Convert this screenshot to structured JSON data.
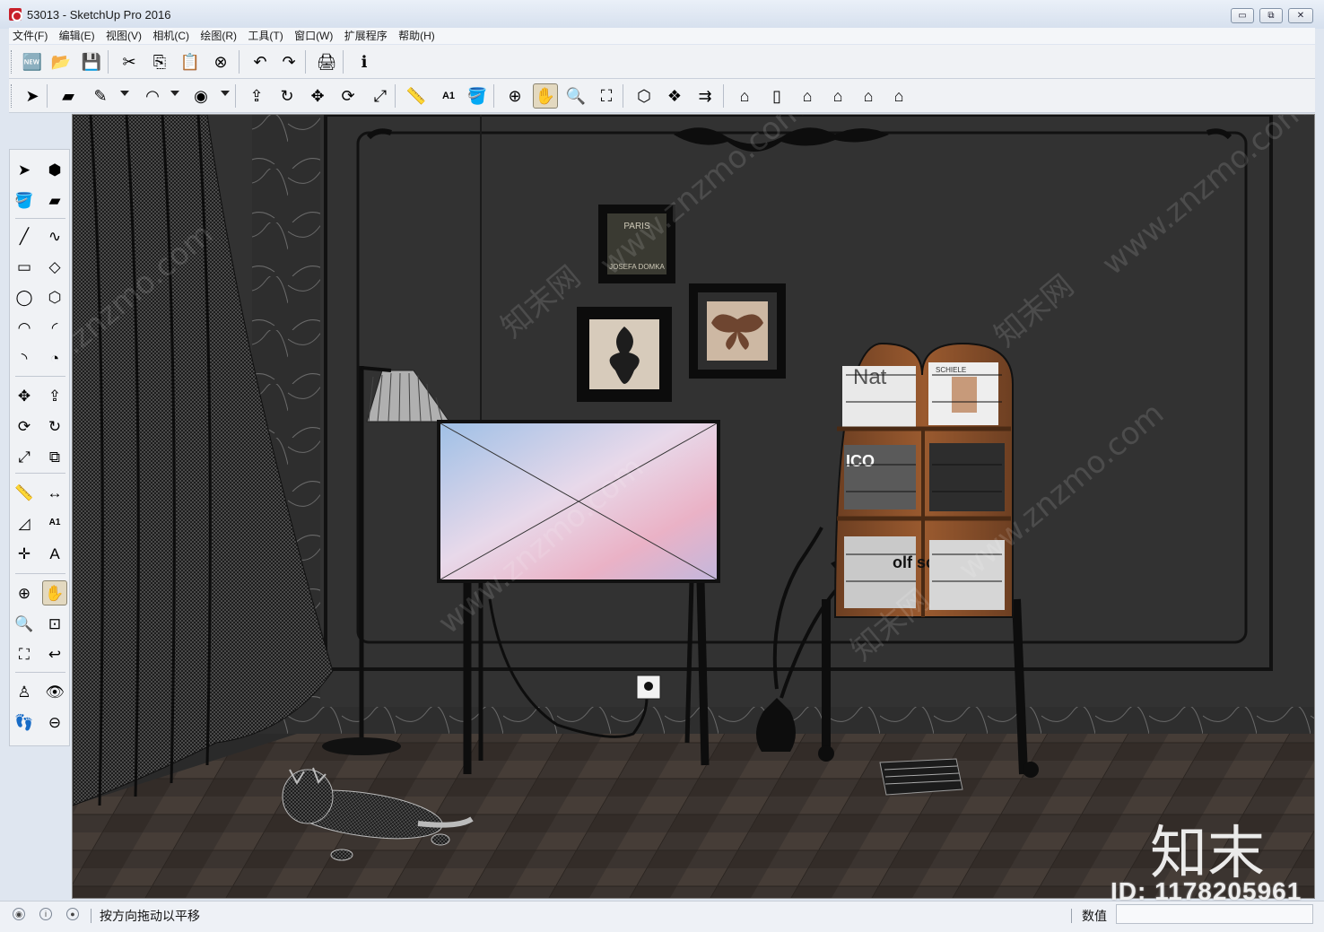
{
  "window": {
    "title": "53013 - SketchUp Pro 2016",
    "minimize_glyph": "▭",
    "restore_glyph": "⧉",
    "close_glyph": "✕"
  },
  "menu": [
    "文件(F)",
    "编辑(E)",
    "视图(V)",
    "相机(C)",
    "绘图(R)",
    "工具(T)",
    "窗口(W)",
    "扩展程序",
    "帮助(H)"
  ],
  "toolbar_standard": [
    {
      "icon": "new-model-icon",
      "glyph": "🆕"
    },
    {
      "icon": "open-folder-icon",
      "glyph": "📂"
    },
    {
      "icon": "save-icon",
      "glyph": "💾"
    },
    {
      "icon": "cut-icon",
      "glyph": "✂"
    },
    {
      "icon": "copy-icon",
      "glyph": "⎘"
    },
    {
      "icon": "paste-icon",
      "glyph": "📋"
    },
    {
      "icon": "delete-icon",
      "glyph": "⊗"
    },
    {
      "icon": "undo-icon",
      "glyph": "↶"
    },
    {
      "icon": "redo-icon",
      "glyph": "↷"
    },
    {
      "icon": "print-icon",
      "glyph": "🖨"
    },
    {
      "icon": "model-info-icon",
      "glyph": "ℹ"
    }
  ],
  "toolbar_large": [
    {
      "icon": "select-arrow-icon",
      "glyph": "➤"
    },
    {
      "icon": "eraser-icon",
      "glyph": "▰"
    },
    {
      "icon": "pencil-line-icon",
      "glyph": "✎"
    },
    {
      "icon": "arc-icon",
      "glyph": "◠"
    },
    {
      "icon": "circle-icon",
      "glyph": "◉"
    },
    {
      "icon": "push-pull-icon",
      "glyph": "⇪"
    },
    {
      "icon": "follow-me-icon",
      "glyph": "↻"
    },
    {
      "icon": "move-icon",
      "glyph": "✥"
    },
    {
      "icon": "rotate-icon",
      "glyph": "⟳"
    },
    {
      "icon": "scale-icon",
      "glyph": "⤢"
    },
    {
      "icon": "tape-measure-icon",
      "glyph": "📏"
    },
    {
      "icon": "text-icon",
      "glyph": "A1"
    },
    {
      "icon": "paint-bucket-icon",
      "glyph": "🪣"
    },
    {
      "icon": "orbit-icon",
      "glyph": "⊕"
    },
    {
      "icon": "pan-hand-icon",
      "glyph": "✋"
    },
    {
      "icon": "zoom-icon",
      "glyph": "🔍"
    },
    {
      "icon": "zoom-extents-icon",
      "glyph": "⛶"
    },
    {
      "icon": "warehouse-icon",
      "glyph": "⬡"
    },
    {
      "icon": "components-icon",
      "glyph": "❖"
    },
    {
      "icon": "share-model-icon",
      "glyph": "⇉"
    },
    {
      "icon": "iso-view-icon",
      "glyph": "⌂"
    },
    {
      "icon": "front-view-icon",
      "glyph": "▯"
    },
    {
      "icon": "house-top-view-icon",
      "glyph": "⌂"
    },
    {
      "icon": "right-view-icon",
      "glyph": "⌂"
    },
    {
      "icon": "back-view-icon",
      "glyph": "⌂"
    },
    {
      "icon": "left-view-icon",
      "glyph": "⌂"
    }
  ],
  "left_tools": [
    {
      "icon": "select-icon",
      "glyph": "➤"
    },
    {
      "icon": "make-component-icon",
      "glyph": "⬢"
    },
    {
      "icon": "paint-bucket-icon",
      "glyph": "🪣"
    },
    {
      "icon": "eraser-icon",
      "glyph": "▰"
    },
    {
      "icon": "line-icon",
      "glyph": "╱"
    },
    {
      "icon": "freehand-icon",
      "glyph": "∿"
    },
    {
      "icon": "rectangle-icon",
      "glyph": "▭"
    },
    {
      "icon": "rotated-rectangle-icon",
      "glyph": "◇"
    },
    {
      "icon": "circle-icon",
      "glyph": "◯"
    },
    {
      "icon": "polygon-icon",
      "glyph": "⬡"
    },
    {
      "icon": "arc-icon",
      "glyph": "◠"
    },
    {
      "icon": "two-point-arc-icon",
      "glyph": "◜"
    },
    {
      "icon": "three-point-arc-icon",
      "glyph": "◝"
    },
    {
      "icon": "pie-icon",
      "glyph": "◔"
    },
    {
      "icon": "move-icon",
      "glyph": "✥"
    },
    {
      "icon": "push-pull-icon",
      "glyph": "⇪"
    },
    {
      "icon": "rotate-icon",
      "glyph": "⟳"
    },
    {
      "icon": "follow-me-icon",
      "glyph": "↻"
    },
    {
      "icon": "scale-icon",
      "glyph": "⤢"
    },
    {
      "icon": "offset-icon",
      "glyph": "⧉"
    },
    {
      "icon": "tape-measure-icon",
      "glyph": "📏"
    },
    {
      "icon": "dimension-icon",
      "glyph": "↔"
    },
    {
      "icon": "protractor-icon",
      "glyph": "◿"
    },
    {
      "icon": "text-icon",
      "glyph": "A1"
    },
    {
      "icon": "axes-icon",
      "glyph": "✛"
    },
    {
      "icon": "3d-text-icon",
      "glyph": "A"
    },
    {
      "icon": "orbit-icon",
      "glyph": "⊕"
    },
    {
      "icon": "pan-hand-icon",
      "glyph": "✋"
    },
    {
      "icon": "zoom-icon",
      "glyph": "🔍"
    },
    {
      "icon": "zoom-window-icon",
      "glyph": "⊡"
    },
    {
      "icon": "zoom-extents-icon",
      "glyph": "⛶"
    },
    {
      "icon": "previous-view-icon",
      "glyph": "↩"
    },
    {
      "icon": "position-camera-icon",
      "glyph": "♙"
    },
    {
      "icon": "look-around-icon",
      "glyph": "👁"
    },
    {
      "icon": "walk-icon",
      "glyph": "👣"
    },
    {
      "icon": "section-plane-icon",
      "glyph": "⊖"
    }
  ],
  "status": {
    "hint": "按方向拖动以平移",
    "measure_label": "数值",
    "measure_value": ""
  },
  "watermark": {
    "logo": "知末",
    "id": "ID: 1178205961",
    "site": "www.znzmo.com",
    "brand": "知末网"
  },
  "scene_text": {
    "poster_paris": "PARIS",
    "poster_name": "JOSEFA DOMKA",
    "magazine_1": "Nat",
    "magazine_2": "SCHIELE",
    "magazine_3": "ICO",
    "magazine_4": "olf sc"
  }
}
